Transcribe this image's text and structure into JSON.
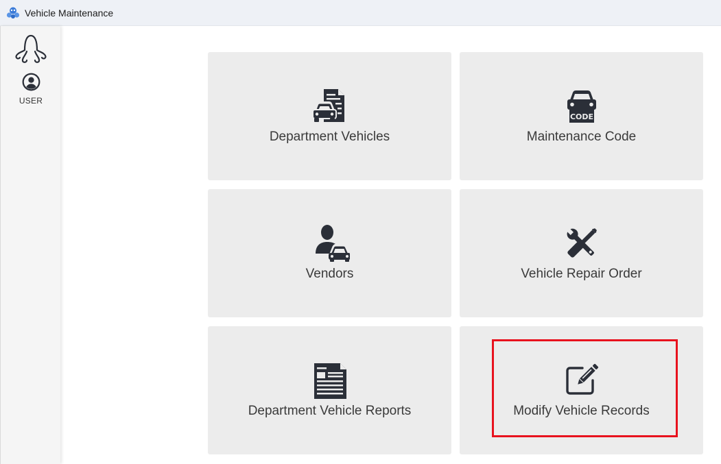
{
  "window": {
    "title": "Vehicle Maintenance",
    "app_icon": "octopus-logo-icon"
  },
  "sidebar": {
    "logo_icon": "octopus-logo-icon",
    "user_label": "USER",
    "user_icon": "user-circle-icon"
  },
  "tiles": [
    {
      "label": "Department Vehicles",
      "icon": "car-document-icon"
    },
    {
      "label": "Maintenance Code",
      "icon": "car-code-icon",
      "icon_text": "CODE"
    },
    {
      "label": "Vendors",
      "icon": "person-car-icon"
    },
    {
      "label": "Vehicle Repair Order",
      "icon": "wrench-screwdriver-icon"
    },
    {
      "label": "Department Vehicle Reports",
      "icon": "newspaper-report-icon"
    },
    {
      "label": "Modify Vehicle Records",
      "icon": "edit-pencil-icon",
      "highlighted": true
    }
  ],
  "colors": {
    "title_bar": "#eef1f6",
    "tile_background": "#ececec",
    "icon": "#2b2f38",
    "highlight": "#e8121e",
    "logo_blue": "#3b7bd8"
  }
}
